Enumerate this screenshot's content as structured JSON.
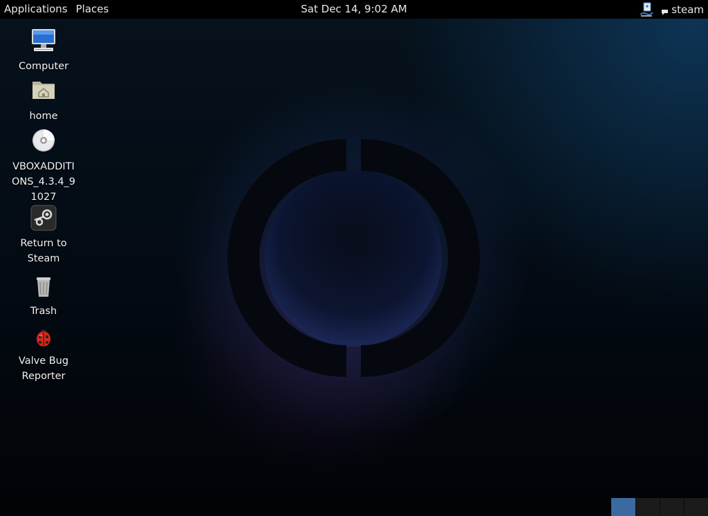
{
  "top_bar": {
    "applications_label": "Applications",
    "places_label": "Places",
    "clock": "Sat Dec 14,  9:02 AM",
    "accessibility_icon": "accessibility-icon",
    "user_name": "steam"
  },
  "desktop_icons": [
    {
      "label": "Computer",
      "icon": "computer-icon"
    },
    {
      "label": "home",
      "icon": "folder-home-icon"
    },
    {
      "label": "VBOXADDITIONS_4.3.4_91027",
      "icon": "cd-disc-icon"
    },
    {
      "label": "Return to Steam",
      "icon": "steam-icon"
    },
    {
      "label": "Trash",
      "icon": "trash-icon"
    },
    {
      "label": "Valve Bug Reporter",
      "icon": "ladybug-icon"
    }
  ],
  "workspace_switcher": {
    "count": 4,
    "active_index": 0
  },
  "colors": {
    "top_bar": "#000000",
    "workspace_active": "#3a6aa0",
    "workspace_inactive": "#1b1b1b"
  }
}
